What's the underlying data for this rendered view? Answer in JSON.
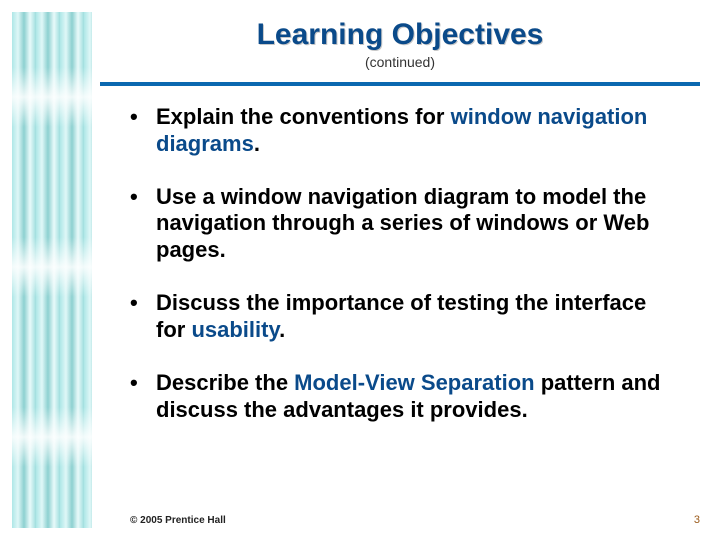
{
  "header": {
    "title": "Learning Objectives",
    "subtitle": "(continued)"
  },
  "bullets": [
    {
      "pre": "Explain the conventions for ",
      "term": "window navigation diagrams",
      "post": "."
    },
    {
      "pre": "Use a window navigation diagram to model the navigation through a series of windows or Web pages.",
      "term": "",
      "post": ""
    },
    {
      "pre": "Discuss the importance of testing the interface for ",
      "term": "usability",
      "post": "."
    },
    {
      "pre": "Describe the ",
      "term": "Model-View Separation",
      "post": " pattern and discuss the advantages it provides."
    }
  ],
  "footer": {
    "copyright": "© 2005  Prentice Hall",
    "page": "3"
  }
}
